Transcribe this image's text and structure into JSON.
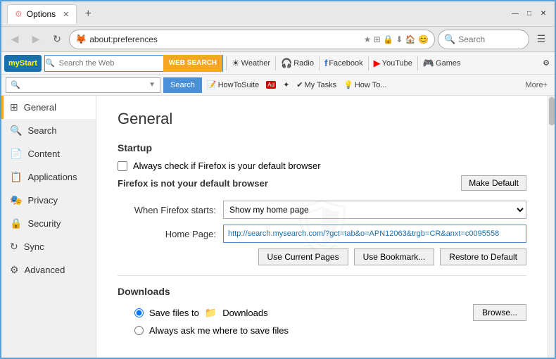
{
  "browser": {
    "title": "Options",
    "tab_label": "Options",
    "url": "about:preferences",
    "search_placeholder": "Search"
  },
  "toolbar": {
    "mystart_logo_my": "my",
    "mystart_logo_start": "Start",
    "search_placeholder": "Search the Web",
    "web_search_label": "WEB SEARCH",
    "weather_label": "Weather",
    "radio_label": "Radio",
    "facebook_label": "Facebook",
    "youtube_label": "YouTube",
    "games_label": "Games",
    "more_label": "More+"
  },
  "toolbar2": {
    "search_placeholder": "",
    "search_btn_label": "Search",
    "howtosuite_label": "HowToSuite",
    "mytasks_label": "My Tasks",
    "howto_label": "How To..."
  },
  "sidebar": {
    "items": [
      {
        "id": "general",
        "label": "General",
        "icon": "⊞",
        "active": true
      },
      {
        "id": "search",
        "label": "Search",
        "icon": "🔍",
        "active": false
      },
      {
        "id": "content",
        "label": "Content",
        "icon": "📄",
        "active": false
      },
      {
        "id": "applications",
        "label": "Applications",
        "icon": "📋",
        "active": false
      },
      {
        "id": "privacy",
        "label": "Privacy",
        "icon": "🎭",
        "active": false
      },
      {
        "id": "security",
        "label": "Security",
        "icon": "🔒",
        "active": false
      },
      {
        "id": "sync",
        "label": "Sync",
        "icon": "↻",
        "active": false
      },
      {
        "id": "advanced",
        "label": "Advanced",
        "icon": "⚙",
        "active": false
      }
    ]
  },
  "content": {
    "page_title": "General",
    "startup_section": "Startup",
    "always_check_label": "Always check if Firefox is your default browser",
    "not_default_text": "Firefox is not your default browser",
    "make_default_btn": "Make Default",
    "when_firefox_starts_label": "When Firefox starts:",
    "when_firefox_starts_value": "Show my home page",
    "home_page_label": "Home Page:",
    "home_page_url": "http://search.mysearch.com/?gct=tab&o=APN12063&trgb=CR&anxt=c0095558",
    "use_current_pages_btn": "Use Current Pages",
    "use_bookmark_btn": "Use Bookmark...",
    "restore_default_btn": "Restore to Default",
    "downloads_section": "Downloads",
    "save_files_label": "Save files to",
    "save_files_folder": "Downloads",
    "browse_btn": "Browse...",
    "always_ask_label": "Always ask me where to save files"
  },
  "nav": {
    "back_disabled": true,
    "forward_disabled": true,
    "refresh_label": "↻"
  }
}
